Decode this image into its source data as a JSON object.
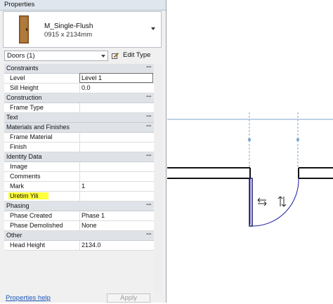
{
  "panel": {
    "title": "Properties"
  },
  "type_selector": {
    "name": "M_Single-Flush",
    "size": "0915 x 2134mm",
    "door_color": "#b07a3a"
  },
  "filter": {
    "label": "Doors (1)",
    "edit_type": "Edit Type"
  },
  "properties": [
    {
      "kind": "section",
      "label": "Constraints"
    },
    {
      "kind": "prop",
      "label": "Level",
      "value": "Level 1",
      "editing": true
    },
    {
      "kind": "prop",
      "label": "Sill Height",
      "value": "0.0"
    },
    {
      "kind": "section",
      "label": "Construction"
    },
    {
      "kind": "prop",
      "label": "Frame Type",
      "value": ""
    },
    {
      "kind": "section",
      "label": "Text"
    },
    {
      "kind": "section",
      "label": "Materials and Finishes"
    },
    {
      "kind": "prop",
      "label": "Frame Material",
      "value": ""
    },
    {
      "kind": "prop",
      "label": "Finish",
      "value": ""
    },
    {
      "kind": "section",
      "label": "Identity Data"
    },
    {
      "kind": "prop",
      "label": "Image",
      "value": ""
    },
    {
      "kind": "prop",
      "label": "Comments",
      "value": ""
    },
    {
      "kind": "prop",
      "label": "Mark",
      "value": "1"
    },
    {
      "kind": "prop",
      "label": "Uretim Yili",
      "value": "",
      "highlight": true
    },
    {
      "kind": "section",
      "label": "Phasing"
    },
    {
      "kind": "prop",
      "label": "Phase Created",
      "value": "Phase 1"
    },
    {
      "kind": "prop",
      "label": "Phase Demolished",
      "value": "None"
    },
    {
      "kind": "section",
      "label": "Other"
    },
    {
      "kind": "prop",
      "label": "Head Height",
      "value": "2134.0"
    }
  ],
  "footer": {
    "help_link": "Properties help",
    "apply": "Apply"
  },
  "colors": {
    "highlight": "#ffff3c",
    "grid_line": "#7fa6c8",
    "link": "#1a55b8"
  },
  "icons": {
    "section_toggle": "chevron-up-icon",
    "edit_type": "edit-type-icon",
    "flip_horizontal": "flip-horizontal-icon",
    "flip_vertical": "flip-vertical-icon"
  }
}
